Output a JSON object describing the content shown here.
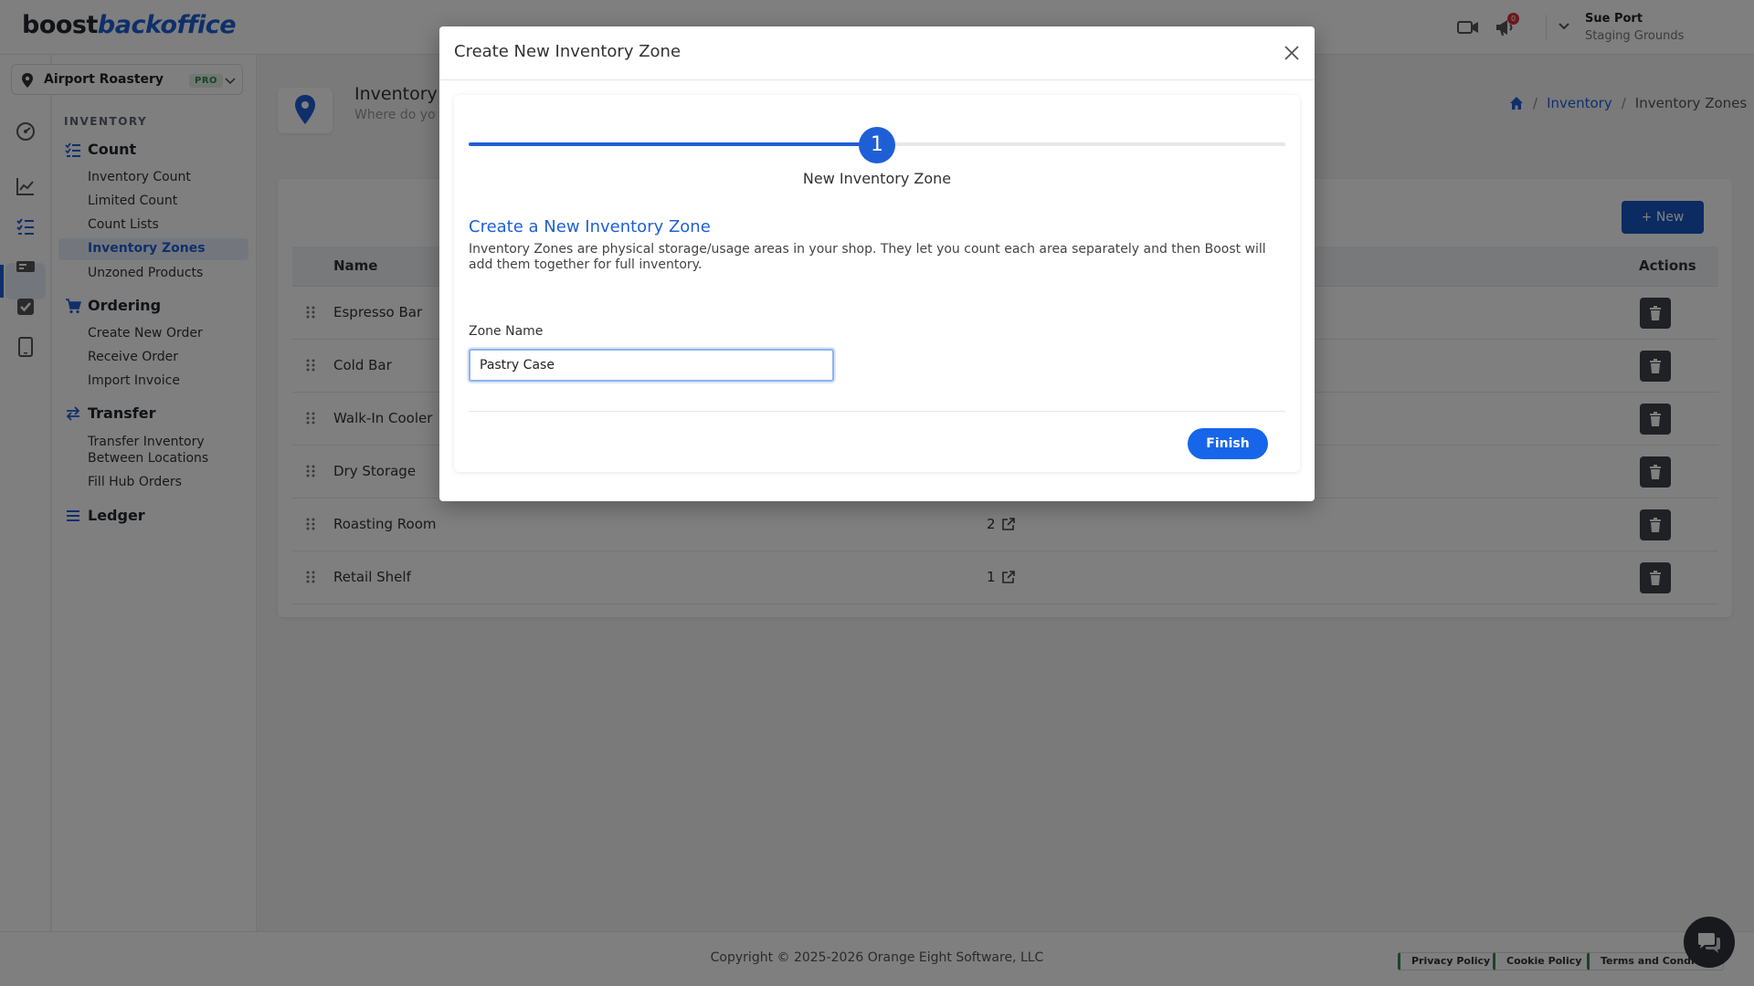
{
  "topbar": {
    "logo_part1": "boost",
    "logo_part2": "backoffice",
    "notification_count": "0",
    "user_name": "Sue Port",
    "user_org": "Staging Grounds",
    "icons": [
      "video-icon",
      "megaphone-icon",
      "chevron-down-icon"
    ]
  },
  "rail": {
    "icons": [
      "dashboard-icon",
      "chart-icon",
      "checklist-icon",
      "register-icon",
      "checkbox-icon",
      "tablet-icon"
    ],
    "active": "checklist-icon"
  },
  "sidebar": {
    "location": "Airport Roastery",
    "plan_badge": "PRO",
    "section_label": "INVENTORY",
    "groups": [
      {
        "title": "Count",
        "icon": "list-check-icon",
        "items": [
          "Inventory Count",
          "Limited Count",
          "Count Lists",
          "Inventory Zones",
          "Unzoned Products"
        ]
      },
      {
        "title": "Ordering",
        "icon": "cart-icon",
        "items": [
          "Create New Order",
          "Receive Order",
          "Import Invoice"
        ]
      },
      {
        "title": "Transfer",
        "icon": "transfer-icon",
        "items": [
          "Transfer Inventory",
          "Between Locations",
          "Fill Hub Orders"
        ]
      },
      {
        "title": "Ledger",
        "icon": "ledger-icon",
        "items": []
      }
    ],
    "active_item": "Inventory Zones"
  },
  "page": {
    "title": "Inventory Zones",
    "subtitle": "Where do you",
    "breadcrumb": {
      "home": "home-icon",
      "link": "Inventory",
      "current": "Inventory Zones",
      "separator": "/"
    },
    "new_button": "+ New"
  },
  "table": {
    "columns": [
      "Name",
      "Actions"
    ],
    "rows": [
      {
        "name": "Espresso Bar",
        "count": ""
      },
      {
        "name": "Cold Bar",
        "count": ""
      },
      {
        "name": "Walk-In Cooler",
        "count": ""
      },
      {
        "name": "Dry Storage",
        "count": ""
      },
      {
        "name": "Roasting Room",
        "count": "2"
      },
      {
        "name": "Retail Shelf",
        "count": "1"
      }
    ]
  },
  "footer": {
    "copyright": "Copyright © 2025-2026 Orange Eight Software, LLC",
    "links": [
      "Privacy Policy",
      "Cookie Policy",
      "Terms and Conditi"
    ]
  },
  "modal": {
    "title": "Create New Inventory Zone",
    "step_number": "1",
    "step_label": "New Inventory Zone",
    "heading": "Create a New Inventory Zone",
    "description": "Inventory Zones are physical storage/usage areas in your shop. They let you count each area separately and then Boost will add them together for full inventory.",
    "field_label": "Zone Name",
    "field_value": "Pastry Case",
    "finish_label": "Finish"
  },
  "colors": {
    "accent": "#1f5fd6",
    "pro_green": "#2f8a4c",
    "danger_badge": "#d9303a"
  }
}
